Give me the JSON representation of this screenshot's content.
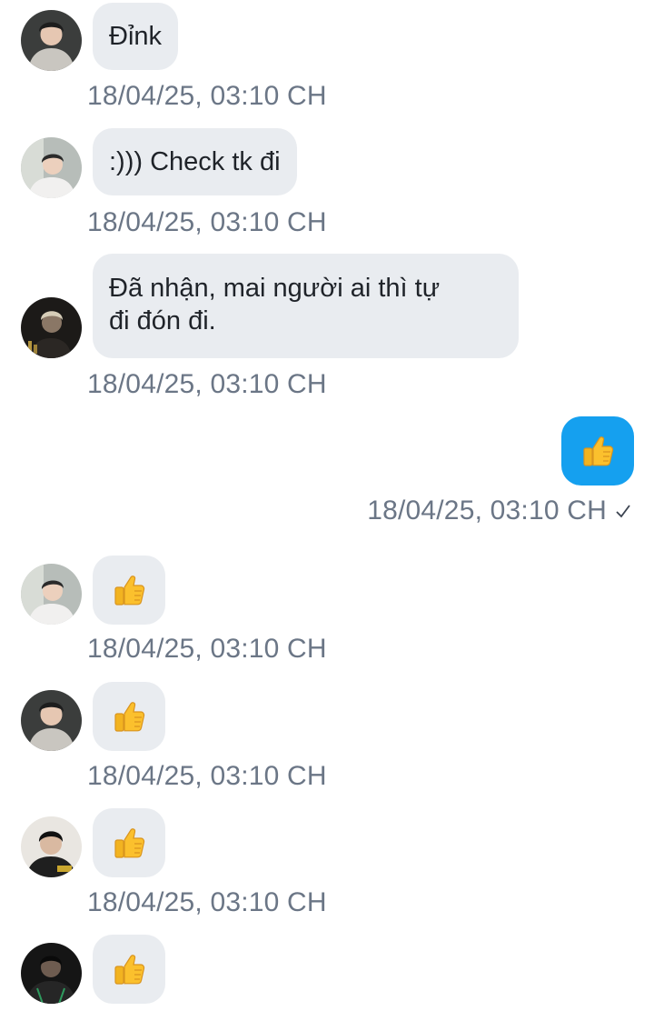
{
  "messages": [
    {
      "sender": "other",
      "avatar": "avatar-1",
      "text": "Đỉnk",
      "time": "18/04/25, 03:10 CH"
    },
    {
      "sender": "other",
      "avatar": "avatar-2",
      "text": ":))) Check tk đi",
      "time": "18/04/25, 03:10 CH"
    },
    {
      "sender": "other",
      "avatar": "avatar-3",
      "text_line1": "Đã nhận, mai người ai thì tự",
      "text_line2": "đi đón đi.",
      "time": "18/04/25, 03:10 CH"
    },
    {
      "sender": "me",
      "emoji": "thumbs-up-icon",
      "time": "18/04/25, 03:10 CH",
      "status_icon": "check-icon"
    },
    {
      "sender": "other",
      "avatar": "avatar-2",
      "emoji": "thumbs-up-icon",
      "time": "18/04/25, 03:10 CH"
    },
    {
      "sender": "other",
      "avatar": "avatar-1",
      "emoji": "thumbs-up-icon",
      "time": "18/04/25, 03:10 CH"
    },
    {
      "sender": "other",
      "avatar": "avatar-4",
      "emoji": "thumbs-up-icon",
      "time": "18/04/25, 03:10 CH"
    },
    {
      "sender": "other",
      "avatar": "avatar-5",
      "emoji": "thumbs-up-icon"
    }
  ],
  "colors": {
    "other_bubble": "#e9ecf0",
    "my_bubble": "#15a0ef",
    "timestamp": "#6b7686",
    "text": "#1f2329"
  }
}
